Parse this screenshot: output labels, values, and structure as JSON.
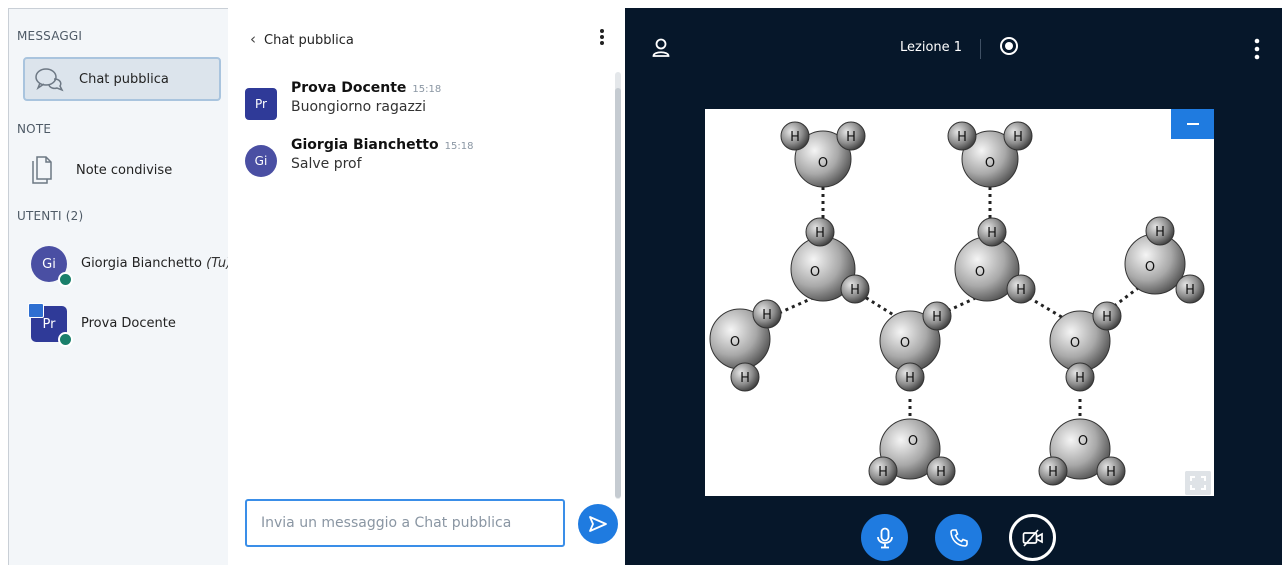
{
  "sidebar": {
    "messages_title": "MESSAGGI",
    "public_chat_label": "Chat pubblica",
    "notes_title": "NOTE",
    "shared_notes_label": "Note condivise",
    "users_title": "UTENTI (2)",
    "users": [
      {
        "initials": "Gi",
        "name": "Giorgia Bianchetto",
        "suffix": "(Tu)"
      },
      {
        "initials": "Pr",
        "name": "Prova Docente",
        "suffix": ""
      }
    ]
  },
  "chat": {
    "header": "Chat pubblica",
    "back_glyph": "‹",
    "messages": [
      {
        "initials": "Pr",
        "author": "Prova Docente",
        "time": "15:18",
        "text": "Buongiorno ragazzi"
      },
      {
        "initials": "Gi",
        "author": "Giorgia Bianchetto",
        "time": "15:18",
        "text": "Salve prof"
      }
    ],
    "input_placeholder": "Invia un messaggio a Chat pubblica"
  },
  "presentation": {
    "title": "Lezione 1"
  },
  "colors": {
    "accent": "#1f7be0",
    "dark_bg": "#06172a",
    "sidebar_bg": "#f3f6f9",
    "avatar_round": "#4a4fa3",
    "avatar_square": "#2f3a98",
    "mic_badge": "#1a7f6b"
  },
  "icons": {
    "chat": "chat-bubbles-icon",
    "notes": "document-icon",
    "send": "send-icon",
    "user": "user-icon",
    "record": "record-icon",
    "kebab": "kebab-icon",
    "mic": "microphone-icon",
    "phone": "phone-icon",
    "camera_off": "camera-off-icon",
    "fullscreen": "fullscreen-icon",
    "minimize": "minimize-icon"
  }
}
